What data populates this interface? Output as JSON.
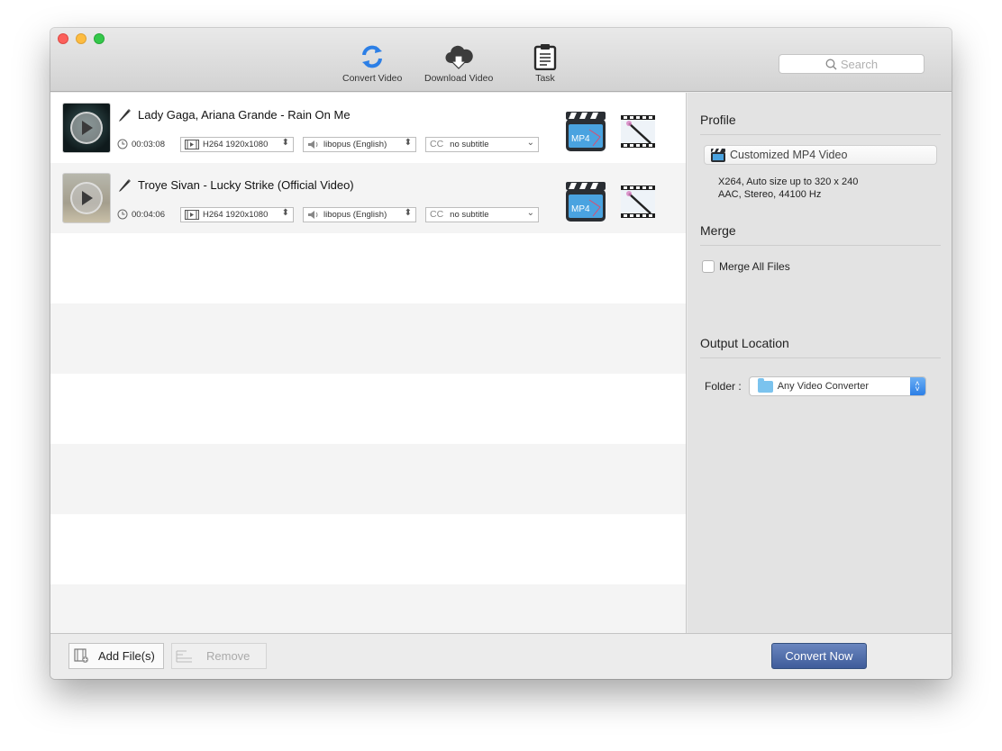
{
  "toolbar": {
    "convert_label": "Convert Video",
    "download_label": "Download Video",
    "task_label": "Task"
  },
  "search": {
    "placeholder": "Search"
  },
  "files": [
    {
      "title": "Lady Gaga, Ariana Grande - Rain On Me",
      "duration": "00:03:08",
      "video": "H264 1920x1080",
      "audio": "libopus (English)",
      "subtitle_prefix": "CC",
      "subtitle": "no subtitle",
      "format_badge": "MP4"
    },
    {
      "title": "Troye Sivan - Lucky Strike (Official Video)",
      "duration": "00:04:06",
      "video": "H264 1920x1080",
      "audio": "libopus (English)",
      "subtitle_prefix": "CC",
      "subtitle": "no subtitle",
      "format_badge": "MP4"
    }
  ],
  "sidebar": {
    "profile_heading": "Profile",
    "profile_value": "Customized MP4 Video",
    "profile_desc_line1": "X264, Auto size up to 320 x 240",
    "profile_desc_line2": "AAC, Stereo, 44100 Hz",
    "merge_heading": "Merge",
    "merge_label": "Merge All Files",
    "merge_checked": false,
    "output_heading": "Output Location",
    "folder_label": "Folder :",
    "folder_value": "Any Video Converter"
  },
  "bottom": {
    "add_label": "Add File(s)",
    "remove_label": "Remove",
    "convert_label": "Convert Now"
  },
  "colors": {
    "accent_blue": "#2c7fe6",
    "convert_button": "#4f6cab",
    "close": "#fc605b",
    "minimize": "#fdbc40",
    "maximize": "#34c84a"
  }
}
